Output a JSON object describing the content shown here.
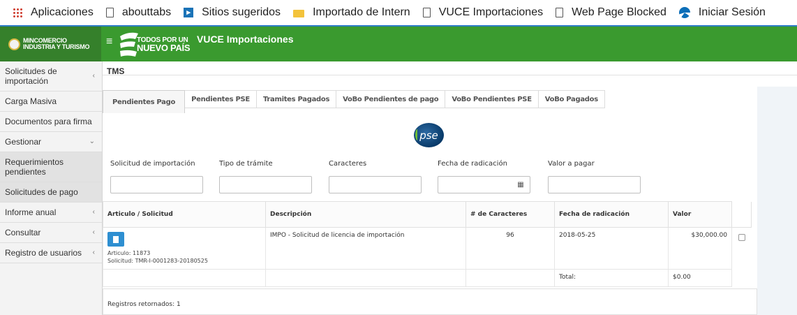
{
  "bookmarks": [
    {
      "label": "Aplicaciones",
      "icon": "apps-grid-icon"
    },
    {
      "label": "abouttabs",
      "icon": "page-icon"
    },
    {
      "label": "Sitios sugeridos",
      "icon": "suggested-sites-icon"
    },
    {
      "label": "Importado de Intern",
      "icon": "folder-icon"
    },
    {
      "label": "VUCE Importaciones",
      "icon": "page-icon"
    },
    {
      "label": "Web Page Blocked",
      "icon": "page-icon"
    },
    {
      "label": "Iniciar Sesión",
      "icon": "login-icon"
    }
  ],
  "header": {
    "ministry_line1": "MINCOMERCIO",
    "ministry_line2": "INDUSTRIA Y TURISMO",
    "menu_glyph": "≡",
    "logo_line1": "TODOS POR UN",
    "logo_line2": "NUEVO PAÍS",
    "app_title": "VUCE Importaciones",
    "colors": {
      "green": "#3a9a2f",
      "dark_green": "#35802b"
    }
  },
  "sidebar": {
    "items": [
      {
        "label": "Solicitudes de importación",
        "chevron": "‹"
      },
      {
        "label": "Carga Masiva",
        "chevron": ""
      },
      {
        "label": "Documentos para firma",
        "chevron": ""
      },
      {
        "label": "Gestionar",
        "chevron": "⌄"
      },
      {
        "label": "Requerimientos pendientes",
        "chevron": ""
      },
      {
        "label": "Solicitudes de pago",
        "chevron": ""
      },
      {
        "label": "Informe anual",
        "chevron": "‹"
      },
      {
        "label": "Consultar",
        "chevron": "‹"
      },
      {
        "label": "Registro de usuarios",
        "chevron": "‹"
      }
    ]
  },
  "main": {
    "breadcrumb": "TMS",
    "tabs": [
      {
        "label": "Pendientes Pago",
        "active": true
      },
      {
        "label": "Pendientes PSE",
        "active": false
      },
      {
        "label": "Tramites Pagados",
        "active": false
      },
      {
        "label": "VoBo Pendientes de pago",
        "active": false
      },
      {
        "label": "VoBo Pendientes PSE",
        "active": false
      },
      {
        "label": "VoBo Pagados",
        "active": false
      }
    ],
    "pse_logo": "pse",
    "filters": {
      "solicitud": {
        "label": "Solicitud de importación",
        "value": ""
      },
      "tipo": {
        "label": "Tipo de trámite",
        "value": ""
      },
      "caracteres": {
        "label": "Caracteres",
        "value": ""
      },
      "fecha": {
        "label": "Fecha de radicación",
        "value": "",
        "icon": "calendar-icon"
      },
      "valor": {
        "label": "Valor a pagar",
        "value": ""
      }
    },
    "table": {
      "headers": [
        "Articulo / Solicitud",
        "Descripción",
        "# de Caracteres",
        "Fecha de radicación",
        "Valor"
      ],
      "row": {
        "articulo": "Articulo: 11873",
        "solicitud": "Solicitud: TMR-I-0001283-20180525",
        "descripcion": "IMPO - Solicitud de licencia de importación",
        "caracteres": "96",
        "fecha": "2018-05-25",
        "valor": "$30,000.00"
      },
      "total_label": "Total:",
      "total_value": "$0.00"
    },
    "registros": "Registros retornados: 1"
  }
}
